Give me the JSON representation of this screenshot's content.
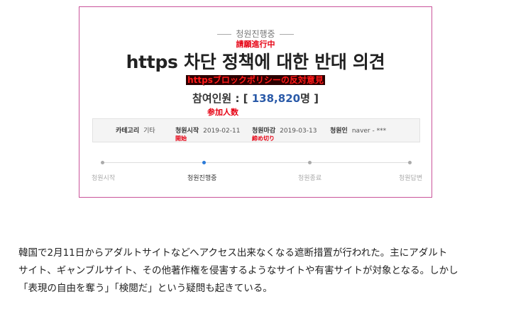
{
  "petition": {
    "status": "청원진행중",
    "status_ja": "請願進行中",
    "title": "https 차단 정책에 대한 반대 의견",
    "title_ja": "httpsブロックポリシーの反対意見",
    "participants_label": "참여인원 : [ ",
    "participants_count": "138,820",
    "participants_suffix": "명 ]",
    "participants_ja": "参加人数",
    "info": {
      "category_label": "카테고리",
      "category_value": "기타",
      "start_label": "청원시작",
      "start_value": "2019-02-11",
      "start_ja": "開始",
      "end_label": "청원마감",
      "end_value": "2019-03-13",
      "end_ja": "締め切り",
      "author_label": "청원인",
      "author_value": "naver - ***"
    },
    "steps": [
      "청원시작",
      "청원진행중",
      "청원종료",
      "청원답변"
    ]
  },
  "article": {
    "lines": [
      "韓国で2月11日からアダルトサイトなどへアクセス出来なくなる遮断措置が行われた。主にアダルト",
      "サイト、ギャンブルサイト、その他著作権を侵害するようなサイトや有害サイトが対象となる。しかし",
      "「表現の自由を奪う」「検閲だ」という疑問も起きている。"
    ]
  },
  "colors": {
    "card_border": "#c9539a",
    "annotation": "#e60012",
    "count": "#2a5aa8",
    "active_step": "#2a7ad8"
  }
}
